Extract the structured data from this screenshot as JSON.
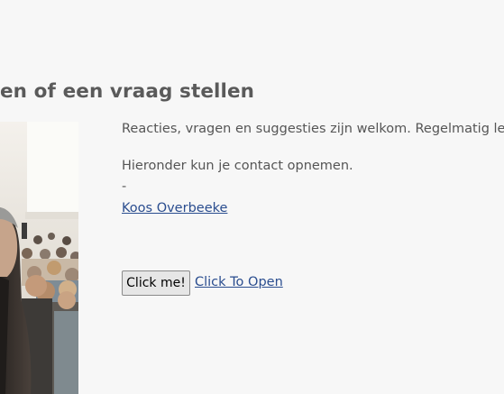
{
  "section": {
    "heading": "en of een vraag stellen"
  },
  "content": {
    "intro": "Reacties, vragen en suggesties zijn welkom. Regelmatig leer",
    "below_text": "Hieronder kun je contact opnemen.",
    "dash": "-",
    "author_link": "Koos Overbeeke"
  },
  "actions": {
    "click_button": "Click me!",
    "open_link": "Click To Open"
  }
}
